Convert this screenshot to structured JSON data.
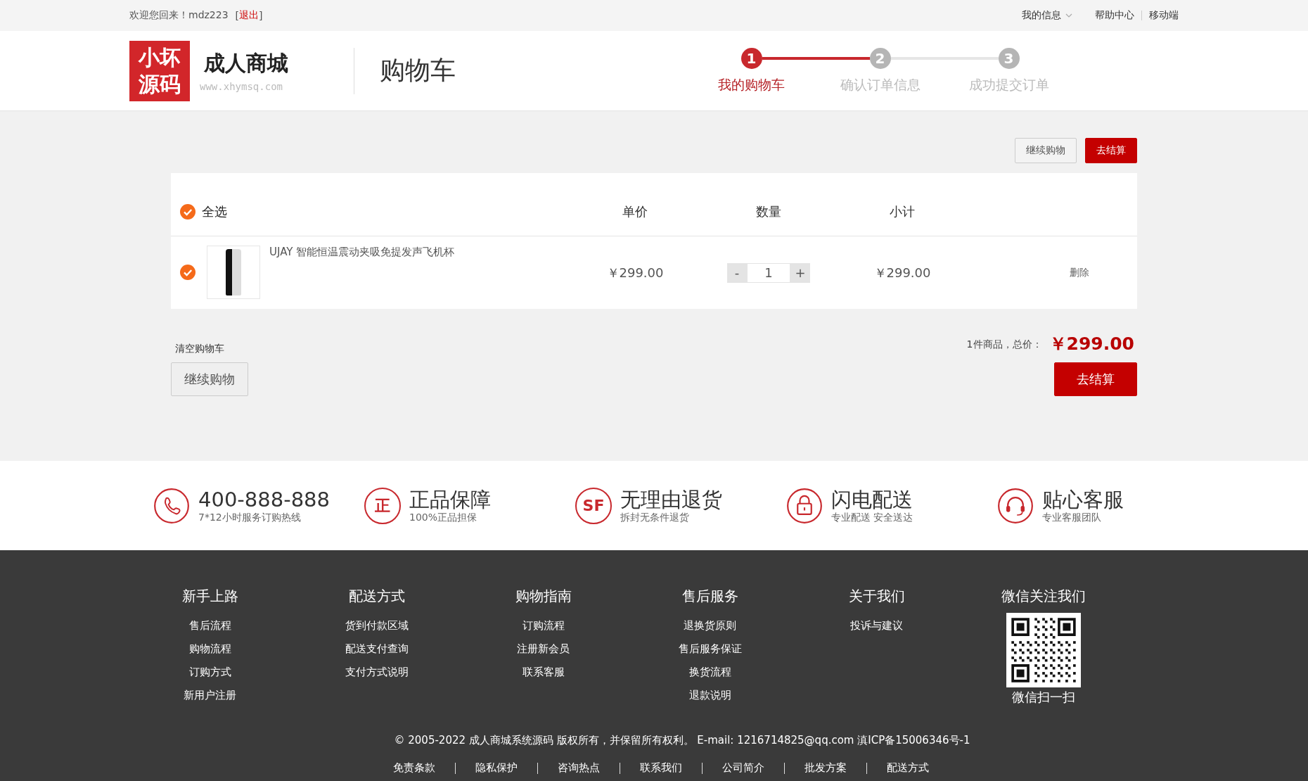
{
  "top_bar": {
    "greeting": "欢迎您回来！mdz223",
    "logout_brackets": [
      "[",
      "]"
    ],
    "logout": "退出",
    "links": [
      {
        "label": "我的信息",
        "dropdown": true
      },
      {
        "label": "帮助中心",
        "dropdown": false
      },
      {
        "label": "移动端",
        "dropdown": false
      }
    ]
  },
  "header": {
    "logo_lines": [
      "小坏",
      "源码"
    ],
    "shop_name": "成人商城",
    "shop_url": "www.xhymsq.com",
    "page_title": "购物车",
    "steps": [
      {
        "number": "1",
        "label": "我的购物车",
        "selected": true
      },
      {
        "number": "2",
        "label": "确认订单信息",
        "selected": false
      },
      {
        "number": "3",
        "label": "成功提交订单",
        "selected": false
      }
    ]
  },
  "top_actions": [
    {
      "label": "继续购物",
      "kind": "secondary"
    },
    {
      "label": "去结算",
      "kind": "primary"
    }
  ],
  "cart": {
    "select_all": {
      "label": "全选",
      "checked": true
    },
    "columns": [
      "单价",
      "数量",
      "小计"
    ],
    "items": [
      {
        "checked": true,
        "name": "UJAY 智能恒温震动夹吸免提发声飞机杯",
        "price": "￥299.00",
        "minus": "-",
        "quantity": "1",
        "plus": "+",
        "subtotal": "￥299.00",
        "delete": "删除"
      }
    ]
  },
  "summary": {
    "clear": "清空购物车",
    "count": "1件商品，总价：",
    "total": "￥299.00"
  },
  "bottom_actions": [
    {
      "label": "继续购物",
      "kind": "secondary"
    },
    {
      "label": "去结算",
      "kind": "primary"
    }
  ],
  "services": [
    {
      "kind": "phone",
      "title": "400-888-888",
      "subtitle": "7*12小时服务订购热线"
    },
    {
      "kind": "text",
      "icon_text": "正",
      "title": "正品保障",
      "subtitle": "100%正品担保"
    },
    {
      "kind": "text",
      "icon_text": "SF",
      "title": "无理由退货",
      "subtitle": "拆封无条件退货"
    },
    {
      "kind": "lock",
      "title": "闪电配送",
      "subtitle": "专业配送 安全送达"
    },
    {
      "kind": "headset",
      "title": "贴心客服",
      "subtitle": "专业客服团队"
    }
  ],
  "footer": {
    "columns": [
      {
        "heading": "新手上路",
        "links": [
          "售后流程",
          "购物流程",
          "订购方式",
          "新用户注册"
        ]
      },
      {
        "heading": "配送方式",
        "links": [
          "货到付款区域",
          "配送支付查询",
          "支付方式说明"
        ]
      },
      {
        "heading": "购物指南",
        "links": [
          "订购流程",
          "注册新会员",
          "联系客服"
        ]
      },
      {
        "heading": "售后服务",
        "links": [
          "退换货原则",
          "售后服务保证",
          "换货流程",
          "退款说明"
        ]
      },
      {
        "heading": "关于我们",
        "links": [
          "投诉与建议"
        ]
      }
    ],
    "wechat": {
      "heading": "微信关注我们",
      "caption": "微信扫一扫"
    },
    "copyright": "© 2005-2022 成人商城系统源码 版权所有，并保留所有权利。 E-mail: 1216714825@qq.com 滇ICP备15006346号-1",
    "links": [
      "免责条款",
      "隐私保护",
      "咨询热点",
      "联系我们",
      "公司简介",
      "批发方案",
      "配送方式"
    ]
  }
}
